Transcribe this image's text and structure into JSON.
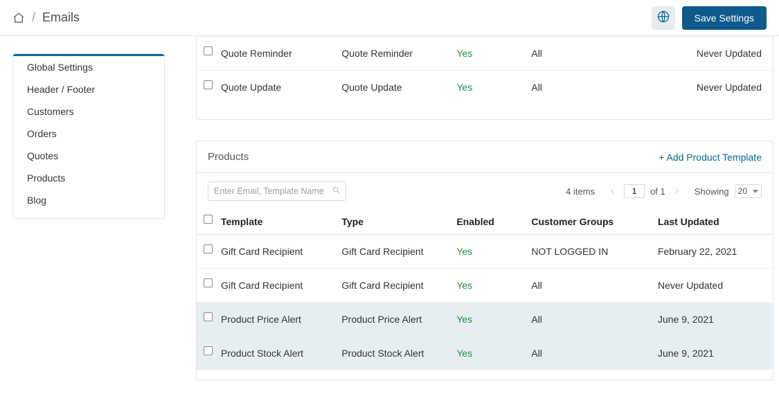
{
  "breadcrumb": {
    "title": "Emails"
  },
  "header": {
    "save_label": "Save Settings"
  },
  "sidebar": {
    "items": [
      {
        "label": "Global Settings"
      },
      {
        "label": "Header / Footer"
      },
      {
        "label": "Customers"
      },
      {
        "label": "Orders"
      },
      {
        "label": "Quotes"
      },
      {
        "label": "Products"
      },
      {
        "label": "Blog"
      }
    ]
  },
  "quotes_partial": {
    "rows": [
      {
        "template": "Quote Reminder",
        "type": "Quote Reminder",
        "enabled": "Yes",
        "groups": "All",
        "updated": "Never Updated"
      },
      {
        "template": "Quote Update",
        "type": "Quote Update",
        "enabled": "Yes",
        "groups": "All",
        "updated": "Never Updated"
      }
    ]
  },
  "products_card": {
    "title": "Products",
    "add_label": "+ Add Product Template",
    "search_placeholder": "Enter Email, Template Name",
    "items_count": "4 items",
    "page_current": "1",
    "page_of": "of 1",
    "showing_label": "Showing",
    "page_size": "20",
    "columns": {
      "template": "Template",
      "type": "Type",
      "enabled": "Enabled",
      "groups": "Customer Groups",
      "updated": "Last Updated"
    },
    "rows": [
      {
        "template": "Gift Card Recipient",
        "type": "Gift Card Recipient",
        "enabled": "Yes",
        "groups": "NOT LOGGED IN",
        "updated": "February 22, 2021",
        "selected": false
      },
      {
        "template": "Gift Card Recipient",
        "type": "Gift Card Recipient",
        "enabled": "Yes",
        "groups": "All",
        "updated": "Never Updated",
        "selected": false
      },
      {
        "template": "Product Price Alert",
        "type": "Product Price Alert",
        "enabled": "Yes",
        "groups": "All",
        "updated": "June 9, 2021",
        "selected": true
      },
      {
        "template": "Product Stock Alert",
        "type": "Product Stock Alert",
        "enabled": "Yes",
        "groups": "All",
        "updated": "June 9, 2021",
        "selected": true
      }
    ]
  }
}
